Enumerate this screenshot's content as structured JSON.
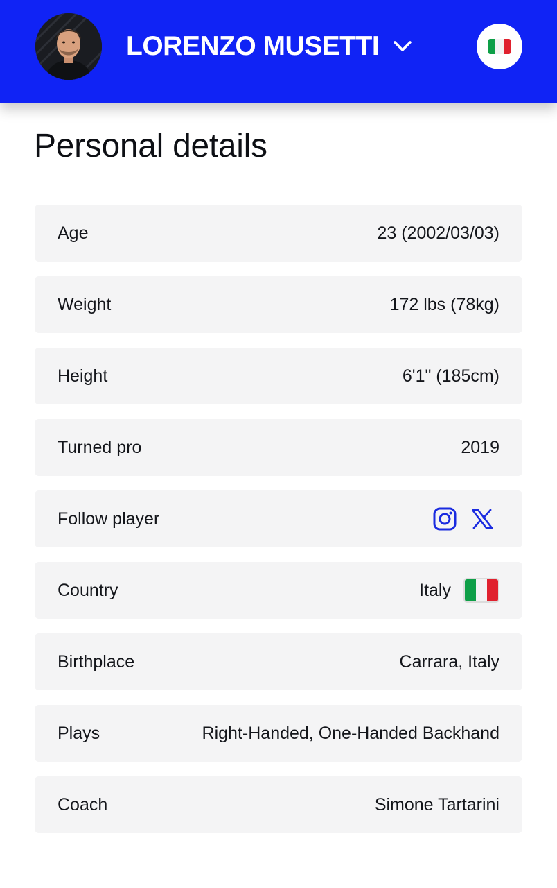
{
  "header": {
    "player_name": "LORENZO MUSETTI",
    "background_color": "#1023f5",
    "avatar_icon": "player-headshot",
    "dropdown_icon": "chevron-down-icon",
    "flag_icon": "italy-flag-icon"
  },
  "section": {
    "title": "Personal details"
  },
  "details": {
    "age": {
      "label": "Age",
      "value": "23 (2002/03/03)"
    },
    "weight": {
      "label": "Weight",
      "value": "172 lbs (78kg)"
    },
    "height": {
      "label": "Height",
      "value": "6'1\" (185cm)"
    },
    "turned_pro": {
      "label": "Turned pro",
      "value": "2019"
    },
    "follow": {
      "label": "Follow player",
      "icons": [
        "instagram-icon",
        "x-icon"
      ],
      "icon_color": "#1a2be0"
    },
    "country": {
      "label": "Country",
      "value": "Italy",
      "flag": "italy-flag-icon"
    },
    "birthplace": {
      "label": "Birthplace",
      "value": "Carrara, Italy"
    },
    "plays": {
      "label": "Plays",
      "value": "Right-Handed, One-Handed Backhand"
    },
    "coach": {
      "label": "Coach",
      "value": "Simone Tartarini"
    }
  }
}
